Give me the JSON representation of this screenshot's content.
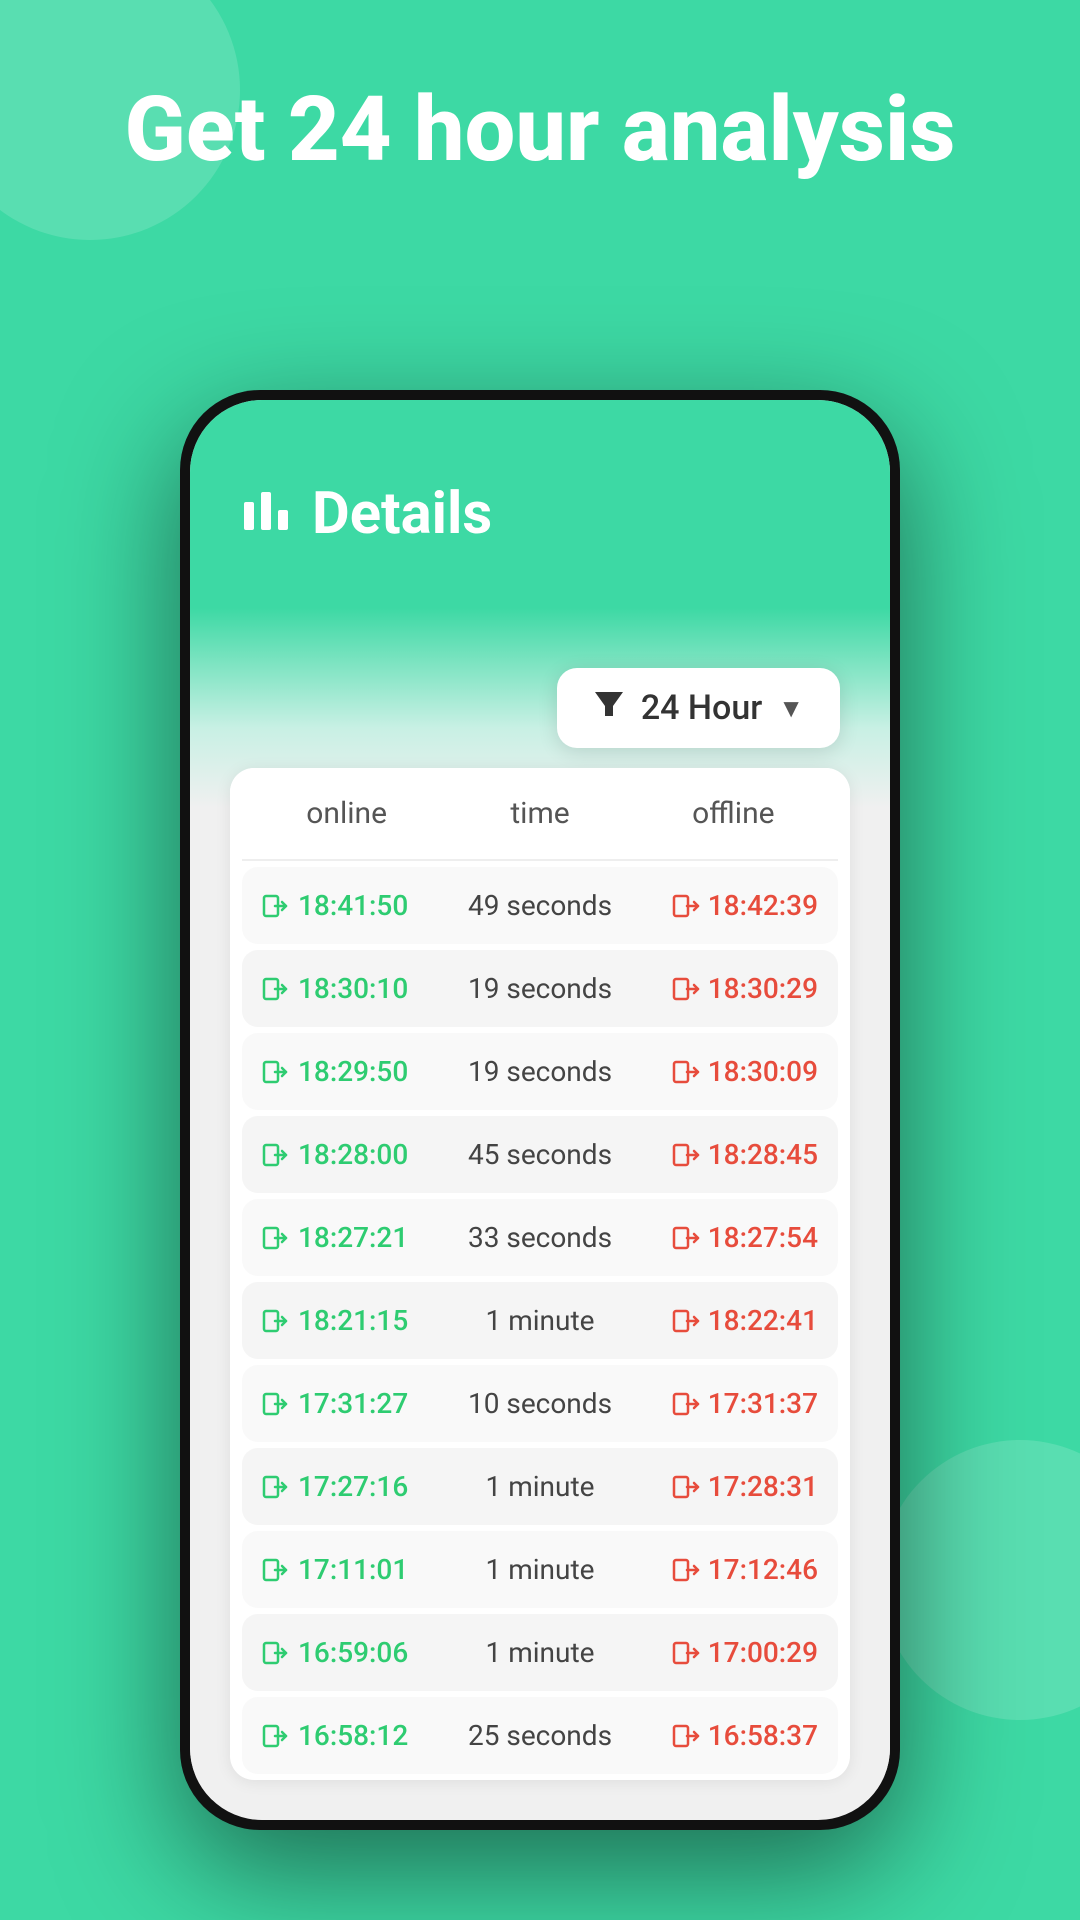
{
  "hero": {
    "title": "Get 24 hour analysis"
  },
  "app": {
    "header": {
      "title": "Details",
      "icon": "📊"
    },
    "filter": {
      "label": "24 Hour",
      "icon": "▼"
    },
    "table": {
      "columns": [
        "online",
        "time",
        "offline"
      ],
      "rows": [
        {
          "online": "18:41:50",
          "time": "49 seconds",
          "offline": "18:42:39"
        },
        {
          "online": "18:30:10",
          "time": "19 seconds",
          "offline": "18:30:29"
        },
        {
          "online": "18:29:50",
          "time": "19 seconds",
          "offline": "18:30:09"
        },
        {
          "online": "18:28:00",
          "time": "45 seconds",
          "offline": "18:28:45"
        },
        {
          "online": "18:27:21",
          "time": "33 seconds",
          "offline": "18:27:54"
        },
        {
          "online": "18:21:15",
          "time": "1 minute",
          "offline": "18:22:41"
        },
        {
          "online": "17:31:27",
          "time": "10 seconds",
          "offline": "17:31:37"
        },
        {
          "online": "17:27:16",
          "time": "1 minute",
          "offline": "17:28:31"
        },
        {
          "online": "17:11:01",
          "time": "1 minute",
          "offline": "17:12:46"
        },
        {
          "online": "16:59:06",
          "time": "1 minute",
          "offline": "17:00:29"
        },
        {
          "online": "16:58:12",
          "time": "25 seconds",
          "offline": "16:58:37"
        }
      ]
    }
  }
}
